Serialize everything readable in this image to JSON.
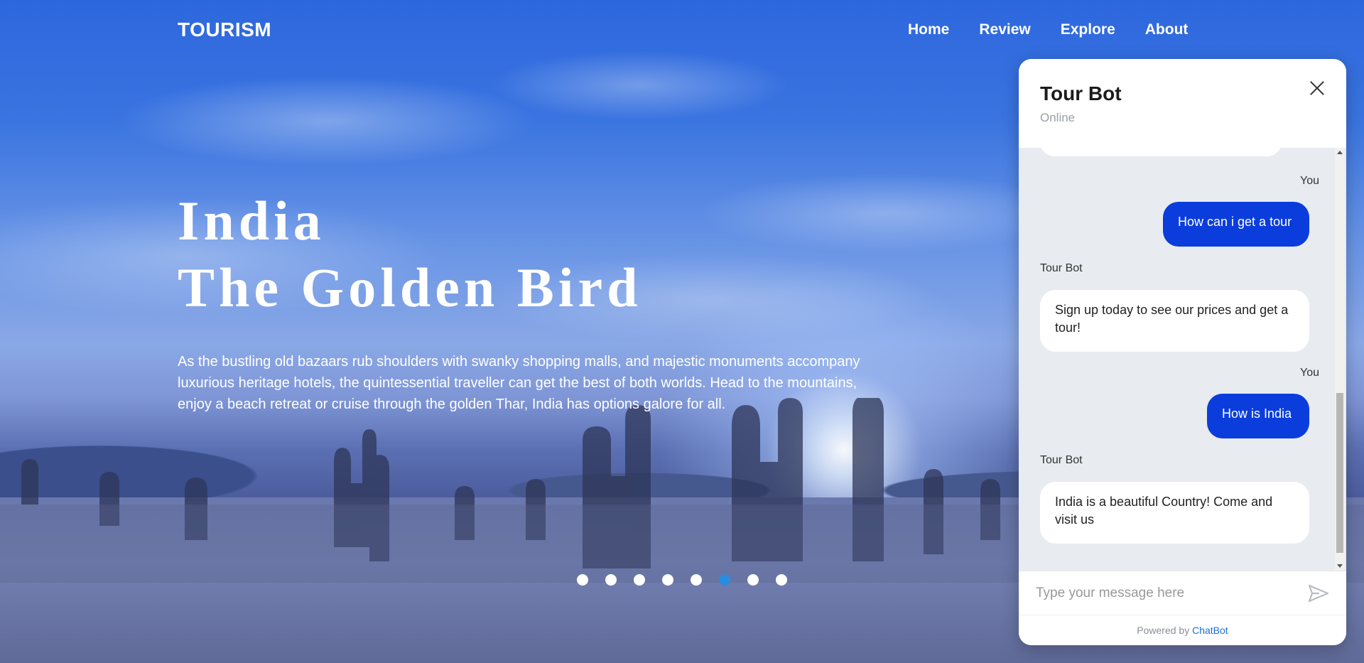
{
  "brand": "TOURISM",
  "nav": {
    "items": [
      "Home",
      "Review",
      "Explore",
      "About"
    ]
  },
  "hero": {
    "title_line1": "India",
    "title_line2": "The Golden Bird",
    "description": "As the bustling old bazaars rub shoulders with swanky shopping malls, and majestic monuments accompany luxurious heritage hotels, the quintessential traveller can get the best of both worlds. Head to the mountains, enjoy a beach retreat or cruise through the golden Thar, India has options galore for all."
  },
  "slider": {
    "count": 8,
    "active_index": 5,
    "active_color": "#2a8ce0"
  },
  "chat": {
    "title": "Tour Bot",
    "status": "Online",
    "close_icon": "close-icon",
    "messages": [
      {
        "sender": "You",
        "text": "How can i get a tour",
        "from": "user"
      },
      {
        "sender": "Tour Bot",
        "text": "Sign up today to see our prices and get a tour!",
        "from": "bot"
      },
      {
        "sender": "You",
        "text": "How is India",
        "from": "user"
      },
      {
        "sender": "Tour Bot",
        "text": "India is a beautiful Country! Come and visit us",
        "from": "bot"
      }
    ],
    "input_placeholder": "Type your message here",
    "send_icon": "send-icon",
    "powered_by": "Powered by",
    "powered_by_link": "ChatBot",
    "user_bubble_color": "#0b3ddd"
  }
}
